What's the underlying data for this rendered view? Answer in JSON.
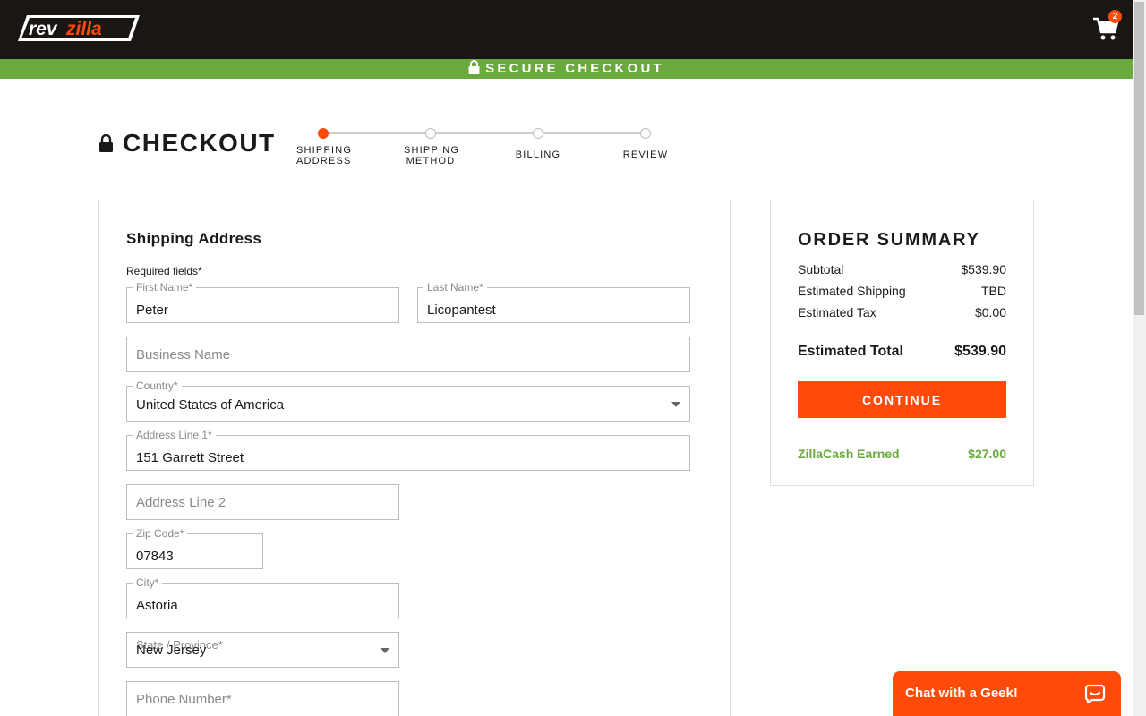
{
  "header": {
    "logo_alt": "revzilla",
    "cart_count": "2",
    "secure_label": "SECURE CHECKOUT"
  },
  "checkout": {
    "title": "CHECKOUT",
    "steps": [
      {
        "label": "SHIPPING\nADDRESS",
        "active": true
      },
      {
        "label": "SHIPPING\nMETHOD",
        "active": false
      },
      {
        "label": "BILLING",
        "active": false
      },
      {
        "label": "REVIEW",
        "active": false
      }
    ]
  },
  "form": {
    "title": "Shipping Address",
    "required_note": "Required fields*",
    "first_name": {
      "label": "First Name*",
      "value": "Peter"
    },
    "last_name": {
      "label": "Last Name*",
      "value": "Licopantest"
    },
    "business": {
      "placeholder": "Business Name"
    },
    "country": {
      "label": "Country*",
      "value": "United States of America"
    },
    "address1": {
      "label": "Address Line 1*",
      "value": "151 Garrett Street"
    },
    "address2": {
      "placeholder": "Address Line 2"
    },
    "zip": {
      "label": "Zip Code*",
      "value": "07843"
    },
    "city": {
      "label": "City*",
      "value": "Astoria"
    },
    "state": {
      "label": "State / Province*",
      "value": "New Jersey"
    },
    "phone": {
      "placeholder": "Phone Number*"
    }
  },
  "summary": {
    "title": "ORDER SUMMARY",
    "subtotal_label": "Subtotal",
    "subtotal": "$539.90",
    "shipping_label": "Estimated Shipping",
    "shipping": "TBD",
    "tax_label": "Estimated Tax",
    "tax": "$0.00",
    "total_label": "Estimated Total",
    "total": "$539.90",
    "continue_label": "CONTINUE",
    "zillacash_label": "ZillaCash Earned",
    "zillacash": "$27.00"
  },
  "chat": {
    "label": "Chat with a Geek!"
  },
  "colors": {
    "brand_orange": "#ff4a0a",
    "secure_green": "#6aa93e",
    "header_dark": "#1a1614"
  }
}
